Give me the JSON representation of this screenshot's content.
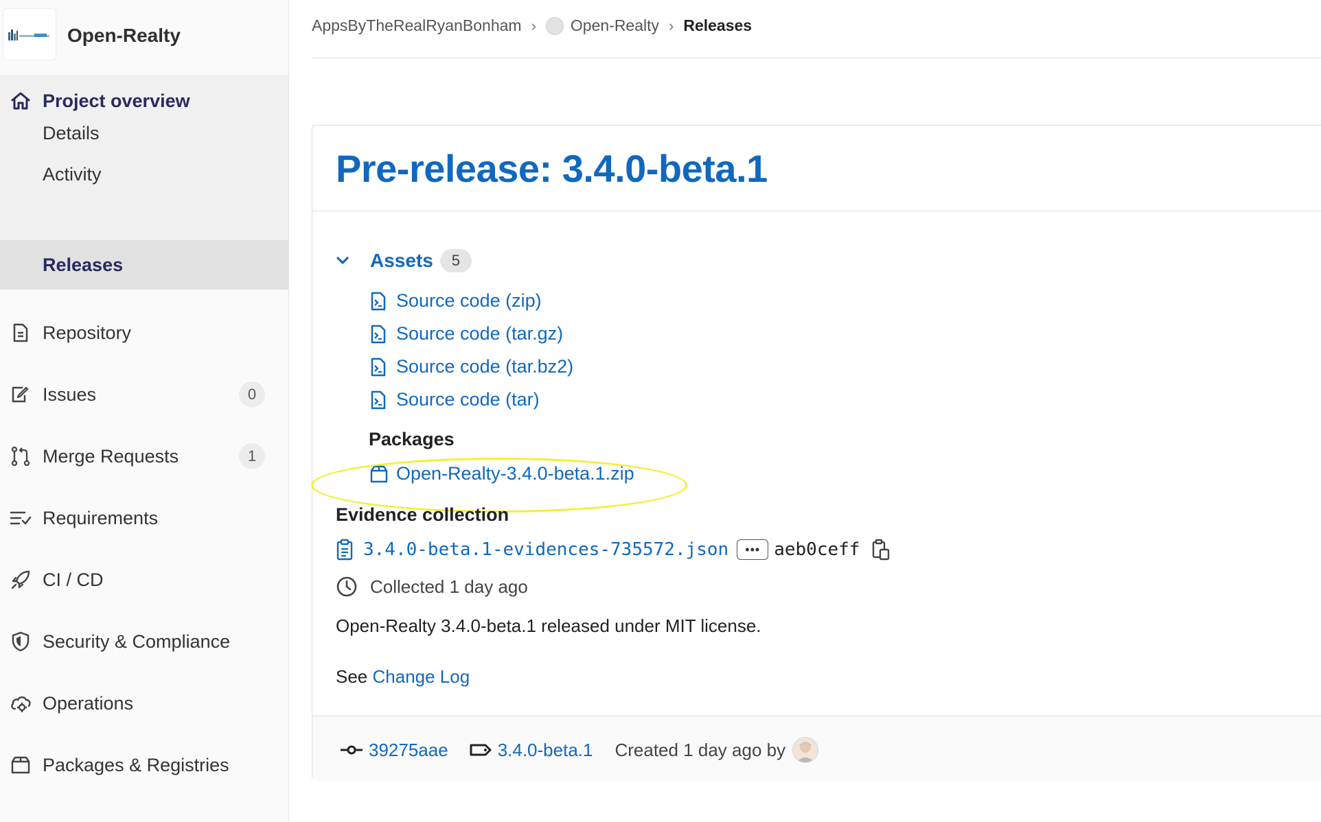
{
  "project": {
    "name": "Open-Realty"
  },
  "sidebar": {
    "project_overview": "Project overview",
    "sub_items": [
      "Details",
      "Activity",
      "Releases"
    ],
    "items": [
      {
        "label": "Repository",
        "icon": "document-icon"
      },
      {
        "label": "Issues",
        "icon": "issues-icon",
        "count": "0"
      },
      {
        "label": "Merge Requests",
        "icon": "merge-request-icon",
        "count": "1"
      },
      {
        "label": "Requirements",
        "icon": "requirements-icon"
      },
      {
        "label": "CI / CD",
        "icon": "rocket-icon"
      },
      {
        "label": "Security & Compliance",
        "icon": "shield-icon"
      },
      {
        "label": "Operations",
        "icon": "cloud-gear-icon"
      },
      {
        "label": "Packages & Registries",
        "icon": "package-icon"
      }
    ]
  },
  "breadcrumb": {
    "owner": "AppsByTheRealRyanBonham",
    "project": "Open-Realty",
    "current": "Releases"
  },
  "release": {
    "title": "Pre-release: 3.4.0-beta.1",
    "assets_label": "Assets",
    "assets_count": "5",
    "sources": [
      "Source code (zip)",
      "Source code (tar.gz)",
      "Source code (tar.bz2)",
      "Source code (tar)"
    ],
    "packages_label": "Packages",
    "package": "Open-Realty-3.4.0-beta.1.zip",
    "evidence_label": "Evidence collection",
    "evidence_file": "3.4.0-beta.1-evidences-735572.json",
    "evidence_sha": "aeb0ceff",
    "collected": "Collected 1 day ago",
    "description": "Open-Realty 3.4.0-beta.1 released under MIT license.",
    "see_label": "See",
    "changelog_link": "Change Log",
    "commit": "39275aae",
    "tag": "3.4.0-beta.1",
    "created": "Created 1 day ago by"
  },
  "colors": {
    "link": "#1068bf",
    "active_nav": "#292961",
    "highlight": "#f3f033"
  }
}
